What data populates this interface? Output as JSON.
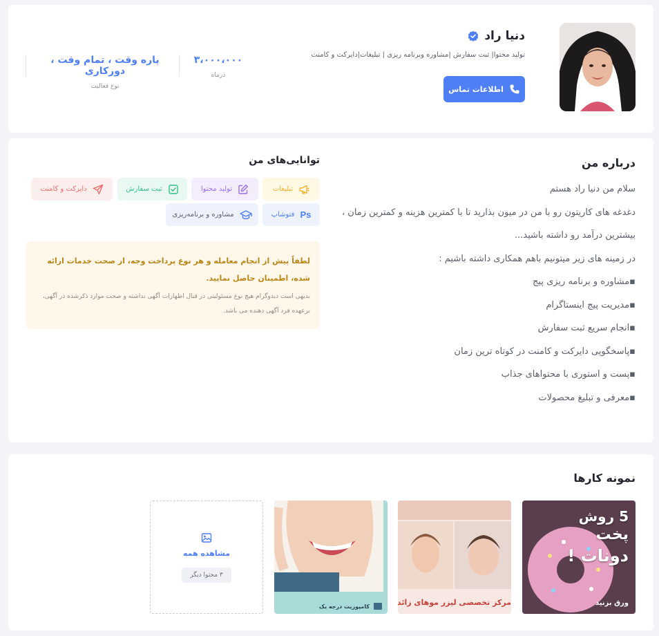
{
  "profile": {
    "name": "دنیا راد",
    "tagline": "تولید محتوا| ثبت سفارش |مشاوره وبرنامه ریزی | تبلیغات|دایرکت و کامنت",
    "contact_label": "اطلاعات تماس",
    "stats": [
      {
        "value": "۳،۰۰۰،۰۰۰",
        "label": "درماه"
      },
      {
        "value": "پاره وقت ، تمام وقت ، دورکاری",
        "label": "نوع فعالیت"
      }
    ]
  },
  "about": {
    "title": "درباره من",
    "lines": [
      "سلام من دنیا راد هستم",
      "دغدغه های کاریتون رو با من در میون بذارید تا با کمترین هزینه و کمترین زمان ،",
      "بیشترین درآمد رو داشته باشید...",
      "در زمینه های زیر میتونیم باهم همکاری داشته باشیم :",
      "▪مشاوره و برنامه ریزی پیج",
      "▪مدیریت پیج اینستاگرام",
      "▪انجام سریع ثبت سفارش",
      "▪پاسخگویی دایرکت و کامنت در کوتاه ترین زمان",
      "▪پست و استوری با محتواهای جذاب",
      "▪معرفی و تبلیغ محصولات"
    ]
  },
  "skills": {
    "title": "توانایی‌های من",
    "items": [
      {
        "label": "تبلیغات",
        "icon": "megaphone-icon",
        "color": "#f2b233",
        "bg": "#fff8e4"
      },
      {
        "label": "تولید محتوا",
        "icon": "edit-icon",
        "color": "#9b6df0",
        "bg": "#f3edfd"
      },
      {
        "label": "ثبت سفارش",
        "icon": "check-square-icon",
        "color": "#2fbf85",
        "bg": "#e9f8f1"
      },
      {
        "label": "دایرکت و کامنت",
        "icon": "send-icon",
        "color": "#f06a6a",
        "bg": "#fdeeee"
      },
      {
        "label": "فتوشاپ",
        "icon": "photoshop-icon",
        "color": "#4f7ff5",
        "bg": "#edf2fd"
      },
      {
        "label": "مشاوره و برنامه‌ریزی",
        "icon": "graduation-cap-icon",
        "color": "#4f7ff5",
        "bg": "#edf2fd"
      }
    ]
  },
  "notice": {
    "bold": "لطفاً پیش از انجام معامله و هر نوع پرداخت وجه، از صحت خدمات ارائه شده، اطمینان حاصل نمایید.",
    "small": "بدیهی است دیدوگرام هیچ نوع مسئولیتی در قبال اظهارات آگهی نداشته و صحت موارد ذکرشده در آگهی، برعهده فرد آگهی دهنده می باشد."
  },
  "portfolio": {
    "title": "نمونه کارها",
    "items": [
      {
        "line1": "5 روش",
        "line2": "پخت",
        "line3": "دونات !",
        "caption": "ورق بزنید"
      },
      {
        "caption": "مرکز تخصصی لیزر موهای زائد"
      },
      {
        "caption": "کامپوزیت درجه یک"
      }
    ],
    "view_all": "مشاهده همه",
    "more": "۳ محتوا دیگر"
  }
}
